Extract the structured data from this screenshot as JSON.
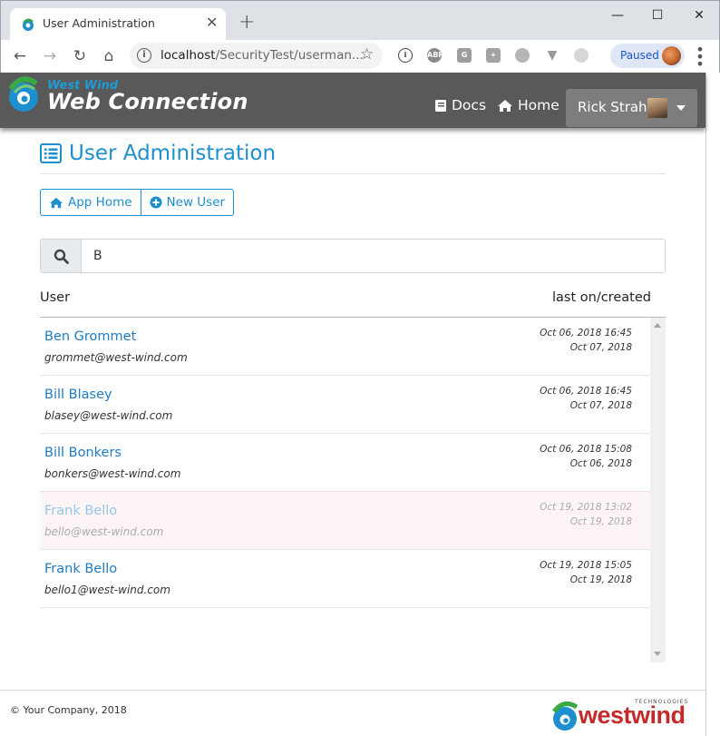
{
  "browser": {
    "tab_title": "User Administration",
    "url_host": "localhost",
    "url_path": "/SecurityTest/userman...",
    "profile_status": "Paused",
    "extensions": [
      "ABP",
      "G"
    ]
  },
  "navbar": {
    "brand_small": "West Wind",
    "brand_big": "Web Connection",
    "docs_label": "Docs",
    "home_label": "Home",
    "user_name": "Rick Strahl"
  },
  "page": {
    "title": "User Administration",
    "app_home_label": "App Home",
    "new_user_label": "New User",
    "search_value": "B",
    "col_user": "User",
    "col_last": "last on/created"
  },
  "users": [
    {
      "name": "Ben Grommet",
      "email": "grommet@west-wind.com",
      "last_on": "Oct 06, 2018 16:45",
      "created": "Oct 07, 2018",
      "inactive": false
    },
    {
      "name": "Bill Blasey",
      "email": "blasey@west-wind.com",
      "last_on": "Oct 06, 2018 16:45",
      "created": "Oct 07, 2018",
      "inactive": false
    },
    {
      "name": "Bill Bonkers",
      "email": "bonkers@west-wind.com",
      "last_on": "Oct 06, 2018 15:08",
      "created": "Oct 06, 2018",
      "inactive": false
    },
    {
      "name": "Frank Bello",
      "email": "bello@west-wind.com",
      "last_on": "Oct 19, 2018 13:02",
      "created": "Oct 19, 2018",
      "inactive": true
    },
    {
      "name": "Frank Bello",
      "email": "bello1@west-wind.com",
      "last_on": "Oct 19, 2018 15:05",
      "created": "Oct 19, 2018",
      "inactive": false
    }
  ],
  "footer": {
    "copyright": "© Your Company, 2018",
    "logo_word": "westwind",
    "logo_tagline": "TECHNOLOGIES"
  },
  "colors": {
    "accent": "#1e8fce",
    "navbar_bg": "#595959",
    "inactive_row_bg": "#fdf5f5"
  }
}
